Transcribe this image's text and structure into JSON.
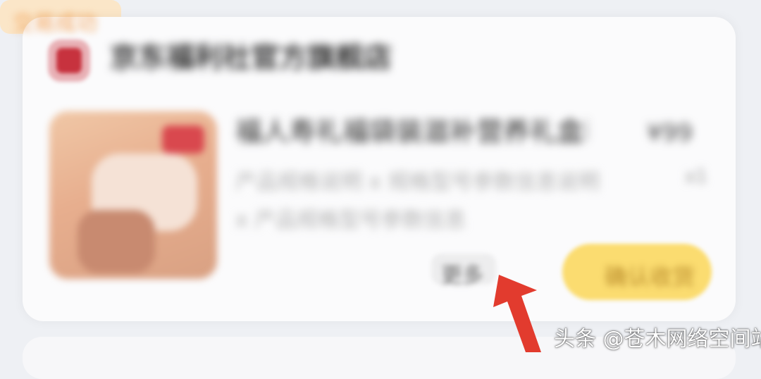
{
  "order_card": {
    "store_name": "京东福利社官方旗舰店",
    "order_status": "交易成功",
    "product_title": "福人寿礼福袋装滋补营养礼盒装",
    "product_price": "¥99",
    "product_qty": "x1",
    "product_desc_line1": "产品规格说明 x 规格型号参数信息说明",
    "product_desc_line2": "x 产品规格型号参数信息",
    "more_button_label": "更多",
    "confirm_button_label": "确认收货"
  },
  "watermark": "头条 @苍木网络空间站",
  "colors": {
    "page_background": "#eef0f4",
    "card_background": "#fbfbfc",
    "confirm_button": "#fbdc70",
    "status_badge": "#fbe6c8",
    "arrow": "#e23b2e"
  }
}
